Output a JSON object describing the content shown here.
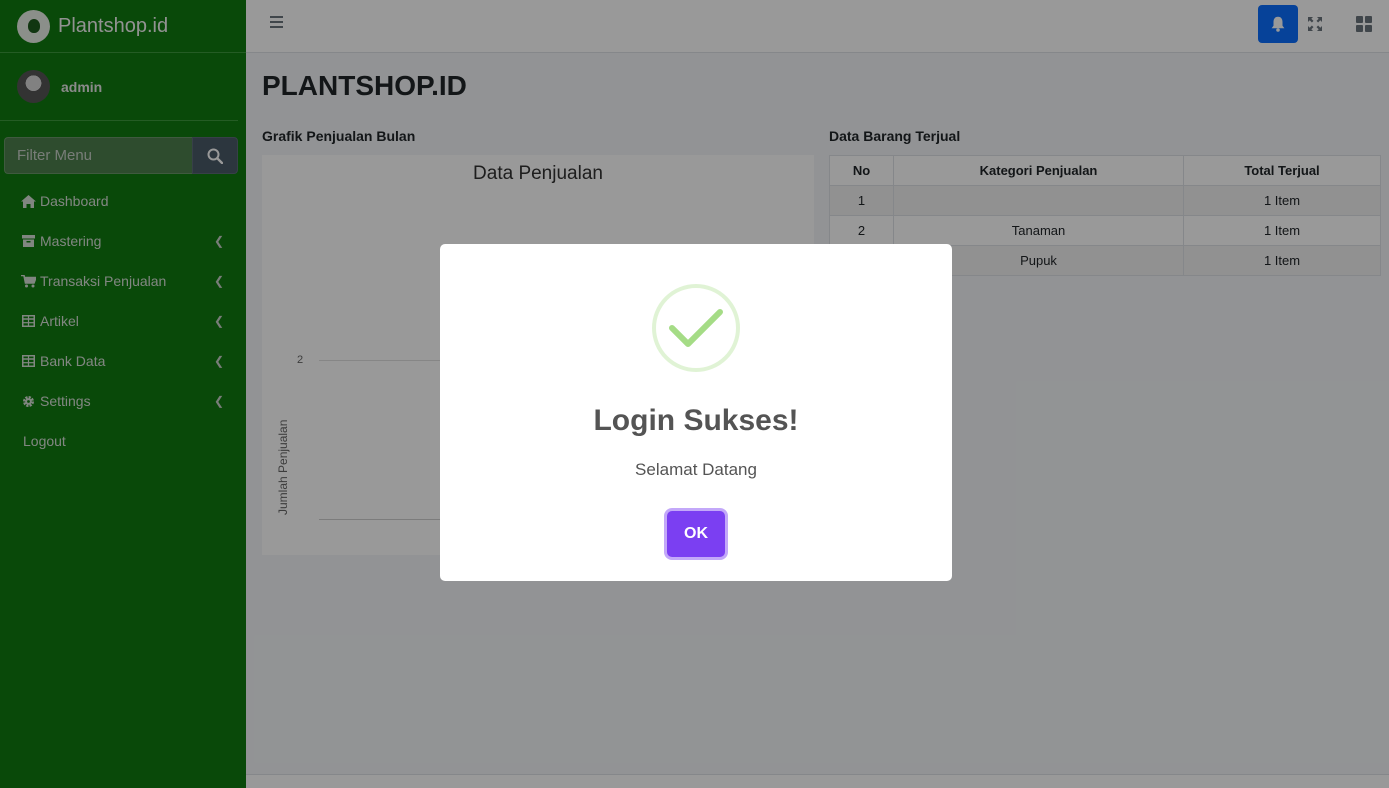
{
  "sidebar": {
    "brand": "Plantshop.id",
    "user": "admin",
    "search_placeholder": "Filter Menu",
    "items": [
      {
        "label": "Dashboard",
        "icon": "home-icon",
        "has_chevron": false
      },
      {
        "label": "Mastering",
        "icon": "archive-icon",
        "has_chevron": true
      },
      {
        "label": "Transaksi Penjualan",
        "icon": "cart-icon",
        "has_chevron": true
      },
      {
        "label": "Artikel",
        "icon": "table-icon",
        "has_chevron": true
      },
      {
        "label": "Bank Data",
        "icon": "table-icon",
        "has_chevron": true
      },
      {
        "label": "Settings",
        "icon": "gear-icon",
        "has_chevron": true
      },
      {
        "label": "Logout",
        "icon": "",
        "has_chevron": false
      }
    ]
  },
  "topbar": {
    "icons": [
      "menu-icon",
      "bell-icon",
      "expand-icon",
      "grid-icon"
    ],
    "accent": "#0b6fff"
  },
  "main": {
    "page_title": "PLANTSHOP.ID",
    "chart_section_title": "Grafik Penjualan Bulan",
    "table_section_title": "Data Barang Terjual"
  },
  "chart_data": {
    "type": "bar",
    "title": "Data Penjualan",
    "ylabel": "Jumlah Penjualan",
    "yticks": [
      "2"
    ]
  },
  "table": {
    "headers": [
      "No",
      "Kategori Penjualan",
      "Total Terjual"
    ],
    "rows": [
      [
        "1",
        "",
        "1 Item"
      ],
      [
        "2",
        "Tanaman",
        "1 Item"
      ],
      [
        "3",
        "Pupuk",
        "1 Item"
      ]
    ]
  },
  "modal": {
    "title": "Login Sukses!",
    "message": "Selamat Datang",
    "ok_label": "OK",
    "icon": "success-check-icon",
    "button_color": "#7b3ff2"
  }
}
